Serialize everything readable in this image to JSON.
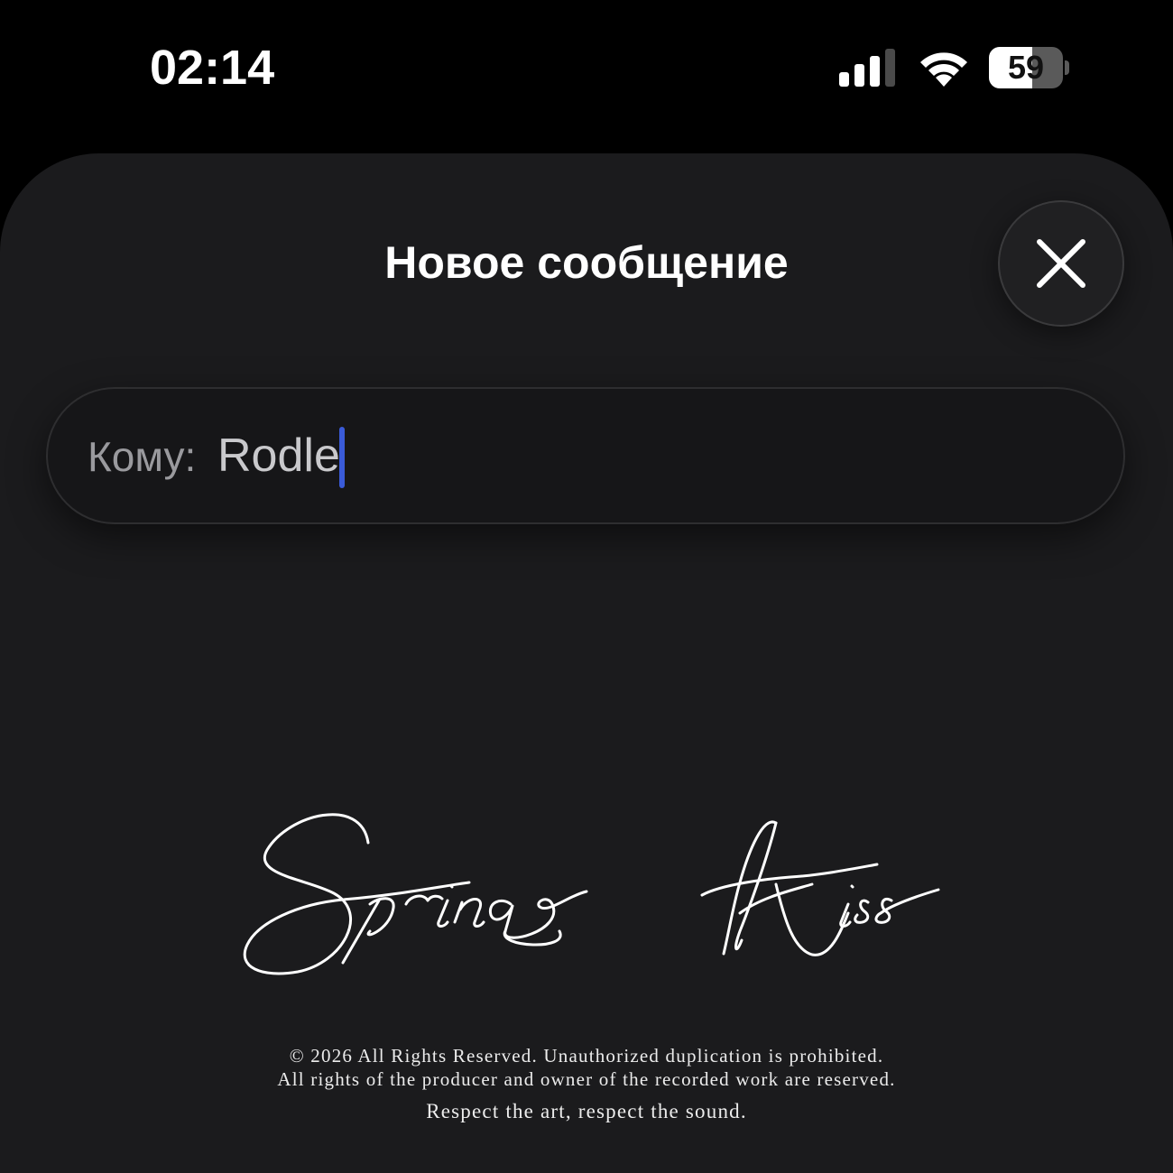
{
  "status_bar": {
    "time": "02:14",
    "battery_level": "59",
    "battery_fraction": 0.59,
    "signal_bars_active": 3,
    "signal_bars_total": 4
  },
  "sheet": {
    "title": "Новое сообщение",
    "close_icon": "close-icon"
  },
  "to_field": {
    "label": "Кому:",
    "value": "Rodle"
  },
  "artwork": {
    "signature_text": "Spring Kiss",
    "copyright_line1": "© 2026 All Rights Reserved. Unauthorized duplication is prohibited.",
    "copyright_line2": "All rights of the producer and owner of the recorded work are reserved.",
    "tagline": "Respect the art, respect the sound."
  },
  "colors": {
    "background": "#000000",
    "sheet": "#1b1b1d",
    "cursor": "#3a5bd8",
    "text_primary": "#ffffff",
    "text_secondary": "#9a9a9e"
  }
}
